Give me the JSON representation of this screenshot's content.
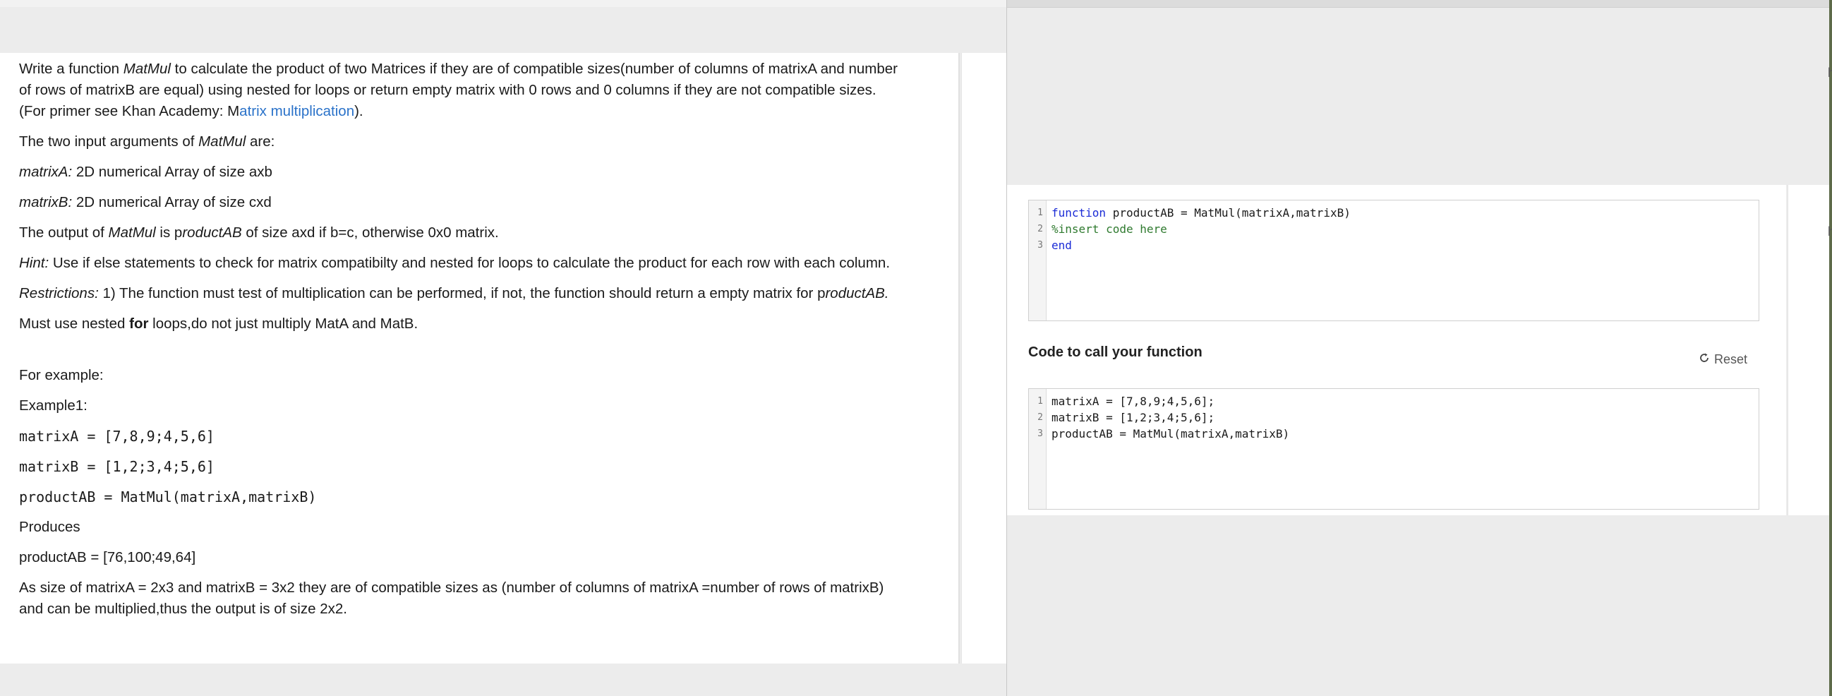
{
  "problem": {
    "intro_a": "Write a function ",
    "intro_func": "MatMul",
    "intro_b": "  to calculate the product of two Matrices if they are of compatible sizes(number of columns of matrixA and number",
    "intro_line2": "of rows of matrixB are equal) using nested for loops or return empty matrix with 0 rows and 0 columns if they are not compatible sizes.",
    "primer_a": "(For primer see Khan Academy:  M",
    "primer_link": "atrix multiplication",
    "primer_b": ").",
    "args_a": "The two input arguments of ",
    "args_func": "MatMul",
    "args_b": " are:",
    "matrixA_label": "matrixA:",
    "matrixA_desc": " 2D numerical Array of size axb",
    "matrixB_label": "matrixB:",
    "matrixB_desc": " 2D numerical Array of size cxd",
    "output_a": "The output of ",
    "output_func": "MatMul",
    "output_b": " is p",
    "output_var": "roductAB",
    "output_c": " of size axd if b=c, otherwise 0x0 matrix.",
    "hint_label": "Hint:",
    "hint_text": " Use if else statements to check for matrix compatibilty and nested for loops to calculate the product for each row with each column.",
    "restrictions_label": "Restrictions:",
    "restrictions_text": " 1) The function must test of multiplication can be performed, if not, the function should return a empty matrix for p",
    "restrictions_var": "roductAB.",
    "must_a": "Must use nested ",
    "must_bold": "for",
    "must_b": " loops,do not just multiply MatA and MatB.",
    "for_example": "For example:",
    "example1": "Example1:",
    "code_a": "matrixA = [7,8,9;4,5,6]",
    "code_b": "matrixB = [1,2;3,4;5,6]",
    "code_c": "productAB = MatMul(matrixA,matrixB)",
    "produces": "Produces",
    "result": "productAB = [76,100;49,64]",
    "explain_line1": "As size of matrixA = 2x3 and matrixB =  3x2 they are of compatible sizes as (number of columns of matrixA =number of rows of matrixB)",
    "explain_line2": "and can be multiplied,thus the output is of size 2x2."
  },
  "function_editor": {
    "line_numbers": [
      "1",
      "2",
      "3"
    ],
    "line1_kw": "function",
    "line1_rest": " productAB = MatMul(matrixA,matrixB)",
    "line2": "%insert code here",
    "line3": "end"
  },
  "call_section": {
    "title": "Code to call your function",
    "reset_label": "Reset",
    "reset_icon": "refresh-icon",
    "line_numbers": [
      "1",
      "2",
      "3"
    ],
    "lines": [
      "matrixA = [7,8,9;4,5,6];",
      "matrixB = [1,2;3,4;5,6];",
      "productAB = MatMul(matrixA,matrixB)"
    ]
  },
  "edge_glyphs": [
    "h",
    "h"
  ],
  "colors": {
    "keyword": "#1a2bd6",
    "comment": "#2f7a2f",
    "link": "#2a72c9",
    "panel_bg": "#ececec"
  }
}
